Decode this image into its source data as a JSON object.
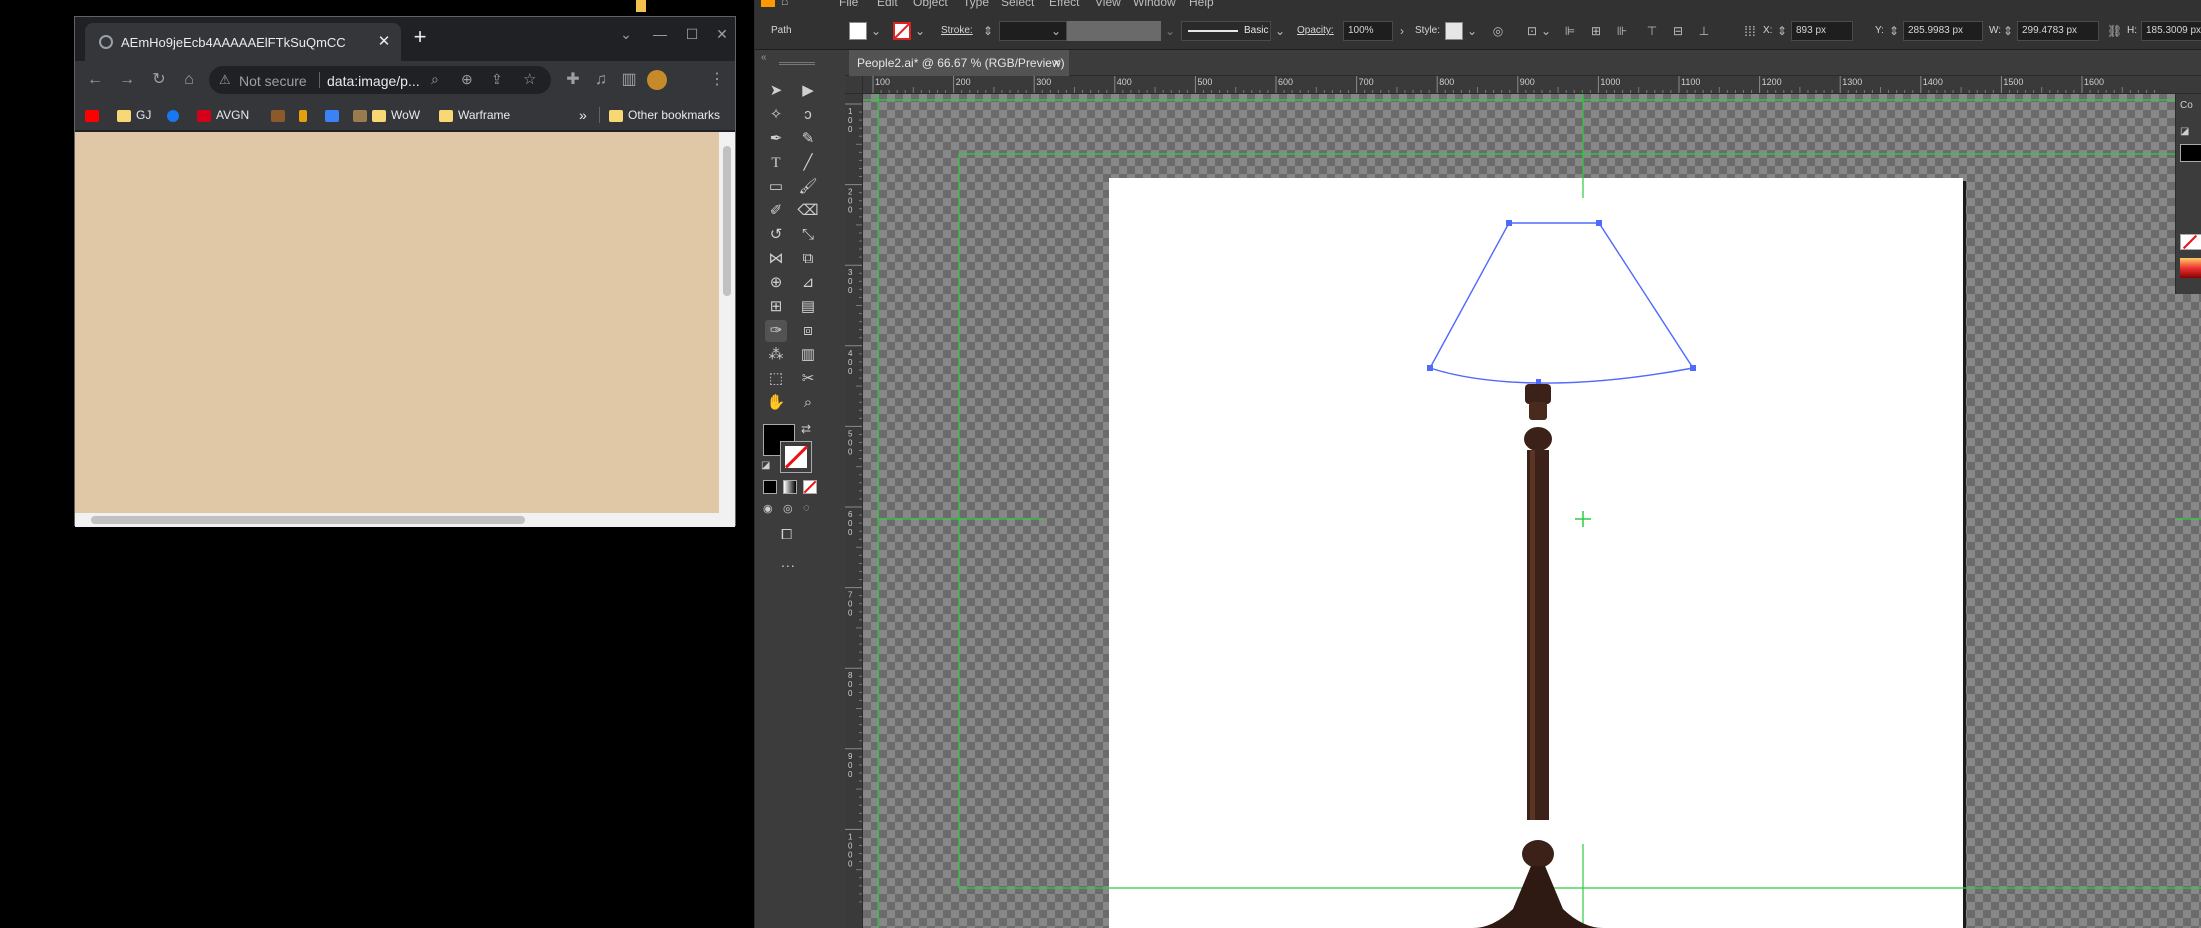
{
  "browser": {
    "tab_title": "AEmHo9jeEcb4AAAAAElFTkSuQmCC",
    "security_label": "Not secure",
    "url": "data:image/p...",
    "bookmarks": [
      "GJ",
      "AVGN",
      "WoW",
      "Warframe"
    ],
    "more_bookmarks": "»",
    "other_bookmarks": "Other bookmarks",
    "page_background": "#e0c7a5"
  },
  "illustrator": {
    "menu": [
      "File",
      "Edit",
      "Object",
      "Type",
      "Select",
      "Effect",
      "View",
      "Window",
      "Help"
    ],
    "control_bar": {
      "selection_type": "Path",
      "stroke_label": "Stroke:",
      "brush_label": "Basic",
      "opacity_label": "Opacity:",
      "opacity_value": "100%",
      "style_label": "Style:",
      "x_label": "X:",
      "x_value": "893 px",
      "y_label": "Y:",
      "y_value": "285.9983 px",
      "w_label": "W:",
      "w_value": "299.4783 px",
      "h_label": "H:",
      "h_value": "185.3009 px"
    },
    "document_tab": "People2.ai* @ 66.67 % (RGB/Preview)",
    "close_tab": "×",
    "more_tools": "...",
    "right_panel_label": "Co",
    "ruler_h_labels": [
      "100",
      "200",
      "300",
      "400",
      "500",
      "600",
      "700",
      "800",
      "900",
      "1000",
      "1100",
      "1200",
      "1300",
      "1400",
      "1500",
      "1600"
    ],
    "ruler_v_labels": [
      "100",
      "200",
      "300",
      "400",
      "500",
      "600",
      "700",
      "800",
      "900",
      "1000"
    ],
    "colors": {
      "ui_dark": "#323232",
      "ui_mid": "#535353",
      "guide": "#2ecc40",
      "selection": "#4f6bff",
      "lamp_wood": "#3b2117"
    }
  }
}
